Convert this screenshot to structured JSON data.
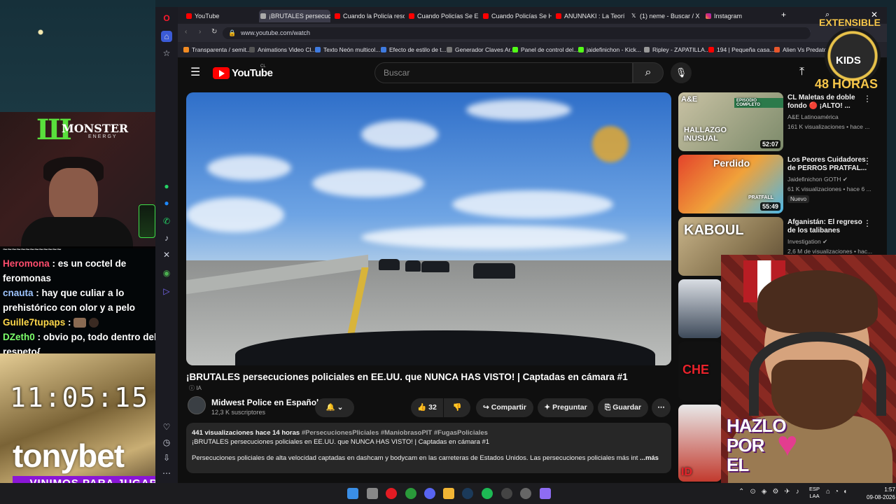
{
  "browser": {
    "tabs": [
      {
        "label": "YouTube",
        "active": false
      },
      {
        "label": "¡BRUTALES persecucio",
        "active": true
      },
      {
        "label": "Cuando la Policía rescata",
        "active": false
      },
      {
        "label": "Cuando Policías Se Enfren",
        "active": false
      },
      {
        "label": "Cuando Policías Se Hartan",
        "active": false
      },
      {
        "label": "ANUNNAKI : La Teoría de",
        "active": false
      },
      {
        "label": "(1) neme - Buscar / X",
        "active": false
      },
      {
        "label": "Instagram",
        "active": false
      }
    ],
    "url": "www.youtube.com/watch",
    "bookmarks": [
      "Transparenta / semit...",
      "Animations Video Cl...",
      "Texto Neón multicol...",
      "Efecto de estilo de t...",
      "Generador Claves Ar...",
      "Panel de control del...",
      "jaidefinichon - Kick...",
      "Ripley - ZAPATILLA...",
      "194 | Pequeña casa...",
      "Alien Vs Predato"
    ]
  },
  "youtube": {
    "logo_text": "YouTube",
    "country_code": "CL",
    "search_placeholder": "Buscar",
    "video": {
      "title": "¡BRUTALES persecuciones policiales en EE.UU. que NUNCA HAS VISTO! | Captadas en cámara #1",
      "ai_label": "IA",
      "channel": "Midwest Police en Español",
      "subscribers": "12,3 K suscriptores",
      "likes": "32",
      "share_label": "Compartir",
      "ask_label": "Preguntar",
      "save_label": "Guardar",
      "views_time": "441 visualizaciones  hace 14 horas",
      "hashtags": "#PersecucionesPliciales #ManiobrasoPIT #FugasPoliciales",
      "desc_line1": "¡BRUTALES persecuciones policiales en EE.UU. que NUNCA  HAS VISTO! | Captadas en cámara #1",
      "desc_line2": "Persecuciones policiales de alta velocidad captadas en dashcam y bodycam en las carreteras de Estados Unidos. Las persecuciones policiales más int",
      "more_label": "...más"
    },
    "recommendations": [
      {
        "title": "CL Maletas de doble fondo 🔴 ¡ALTO! ...",
        "channel": "A&E Latinoamérica",
        "views": "161 K visualizaciones • hace ...",
        "duration": "52:07",
        "thumb_text": "HALLAZGO INUSUAL",
        "thumb_logo": "A&E",
        "thumb_tag": "EPISODIO COMPLETO"
      },
      {
        "title": "Los Peores Cuidadores de PERROS PRATFAL...",
        "channel": "Jaidefinichon GOTH",
        "views": "61 K visualizaciones • hace 6 ...",
        "duration": "55:49",
        "thumb_text": "Perdido",
        "thumb_tag": "PRATFALL",
        "badge": "Nuevo"
      },
      {
        "title": "Afganistán: El regreso de los talibanes",
        "channel": "Investigation",
        "views": "2,6 M de visualizaciones • hac...",
        "thumb_text": "KABOUL"
      },
      {
        "title": "",
        "channel": "",
        "views": ""
      },
      {
        "title": "",
        "channel": "",
        "views": "",
        "thumb_text": "CHE"
      },
      {
        "title": "",
        "channel": "",
        "views": "",
        "thumb_text": "ID"
      }
    ]
  },
  "overlay": {
    "monster_name": "MONSTER",
    "monster_sub": "ENERGY",
    "chat": [
      {
        "user": "Heromona",
        "color": "#ff4d6d",
        "msg": ": es un coctel de feromonas"
      },
      {
        "user": "cnauta",
        "color": "#9ec5ff",
        "msg": ": hay que culiar a lo prehistórico con olor y a pelo"
      },
      {
        "user": "Guille7tupaps",
        "color": "#ffd84a",
        "msg": ":"
      },
      {
        "user": "DZeth0",
        "color": "#7cff6b",
        "msg": ": obvio po, todo dentro del respeto{"
      }
    ],
    "clock": "11:05:15",
    "sponsor": "tonybet",
    "sponsor_tagline": "VINIMOS PARA JUGAR",
    "badge_top": "EXTENSIBLE",
    "badge_mid": "KIDS",
    "badge_bottom": "48 HORAS",
    "hazlo_text": "HAZLO POR EL"
  },
  "taskbar": {
    "lang": "ESP",
    "lang2": "LAA",
    "time": "1:57",
    "date": "09-08-2026"
  },
  "colors": {
    "youtube_red": "#ff0000",
    "accent_purple": "#8a16d6",
    "monster_green": "#59e03c"
  }
}
